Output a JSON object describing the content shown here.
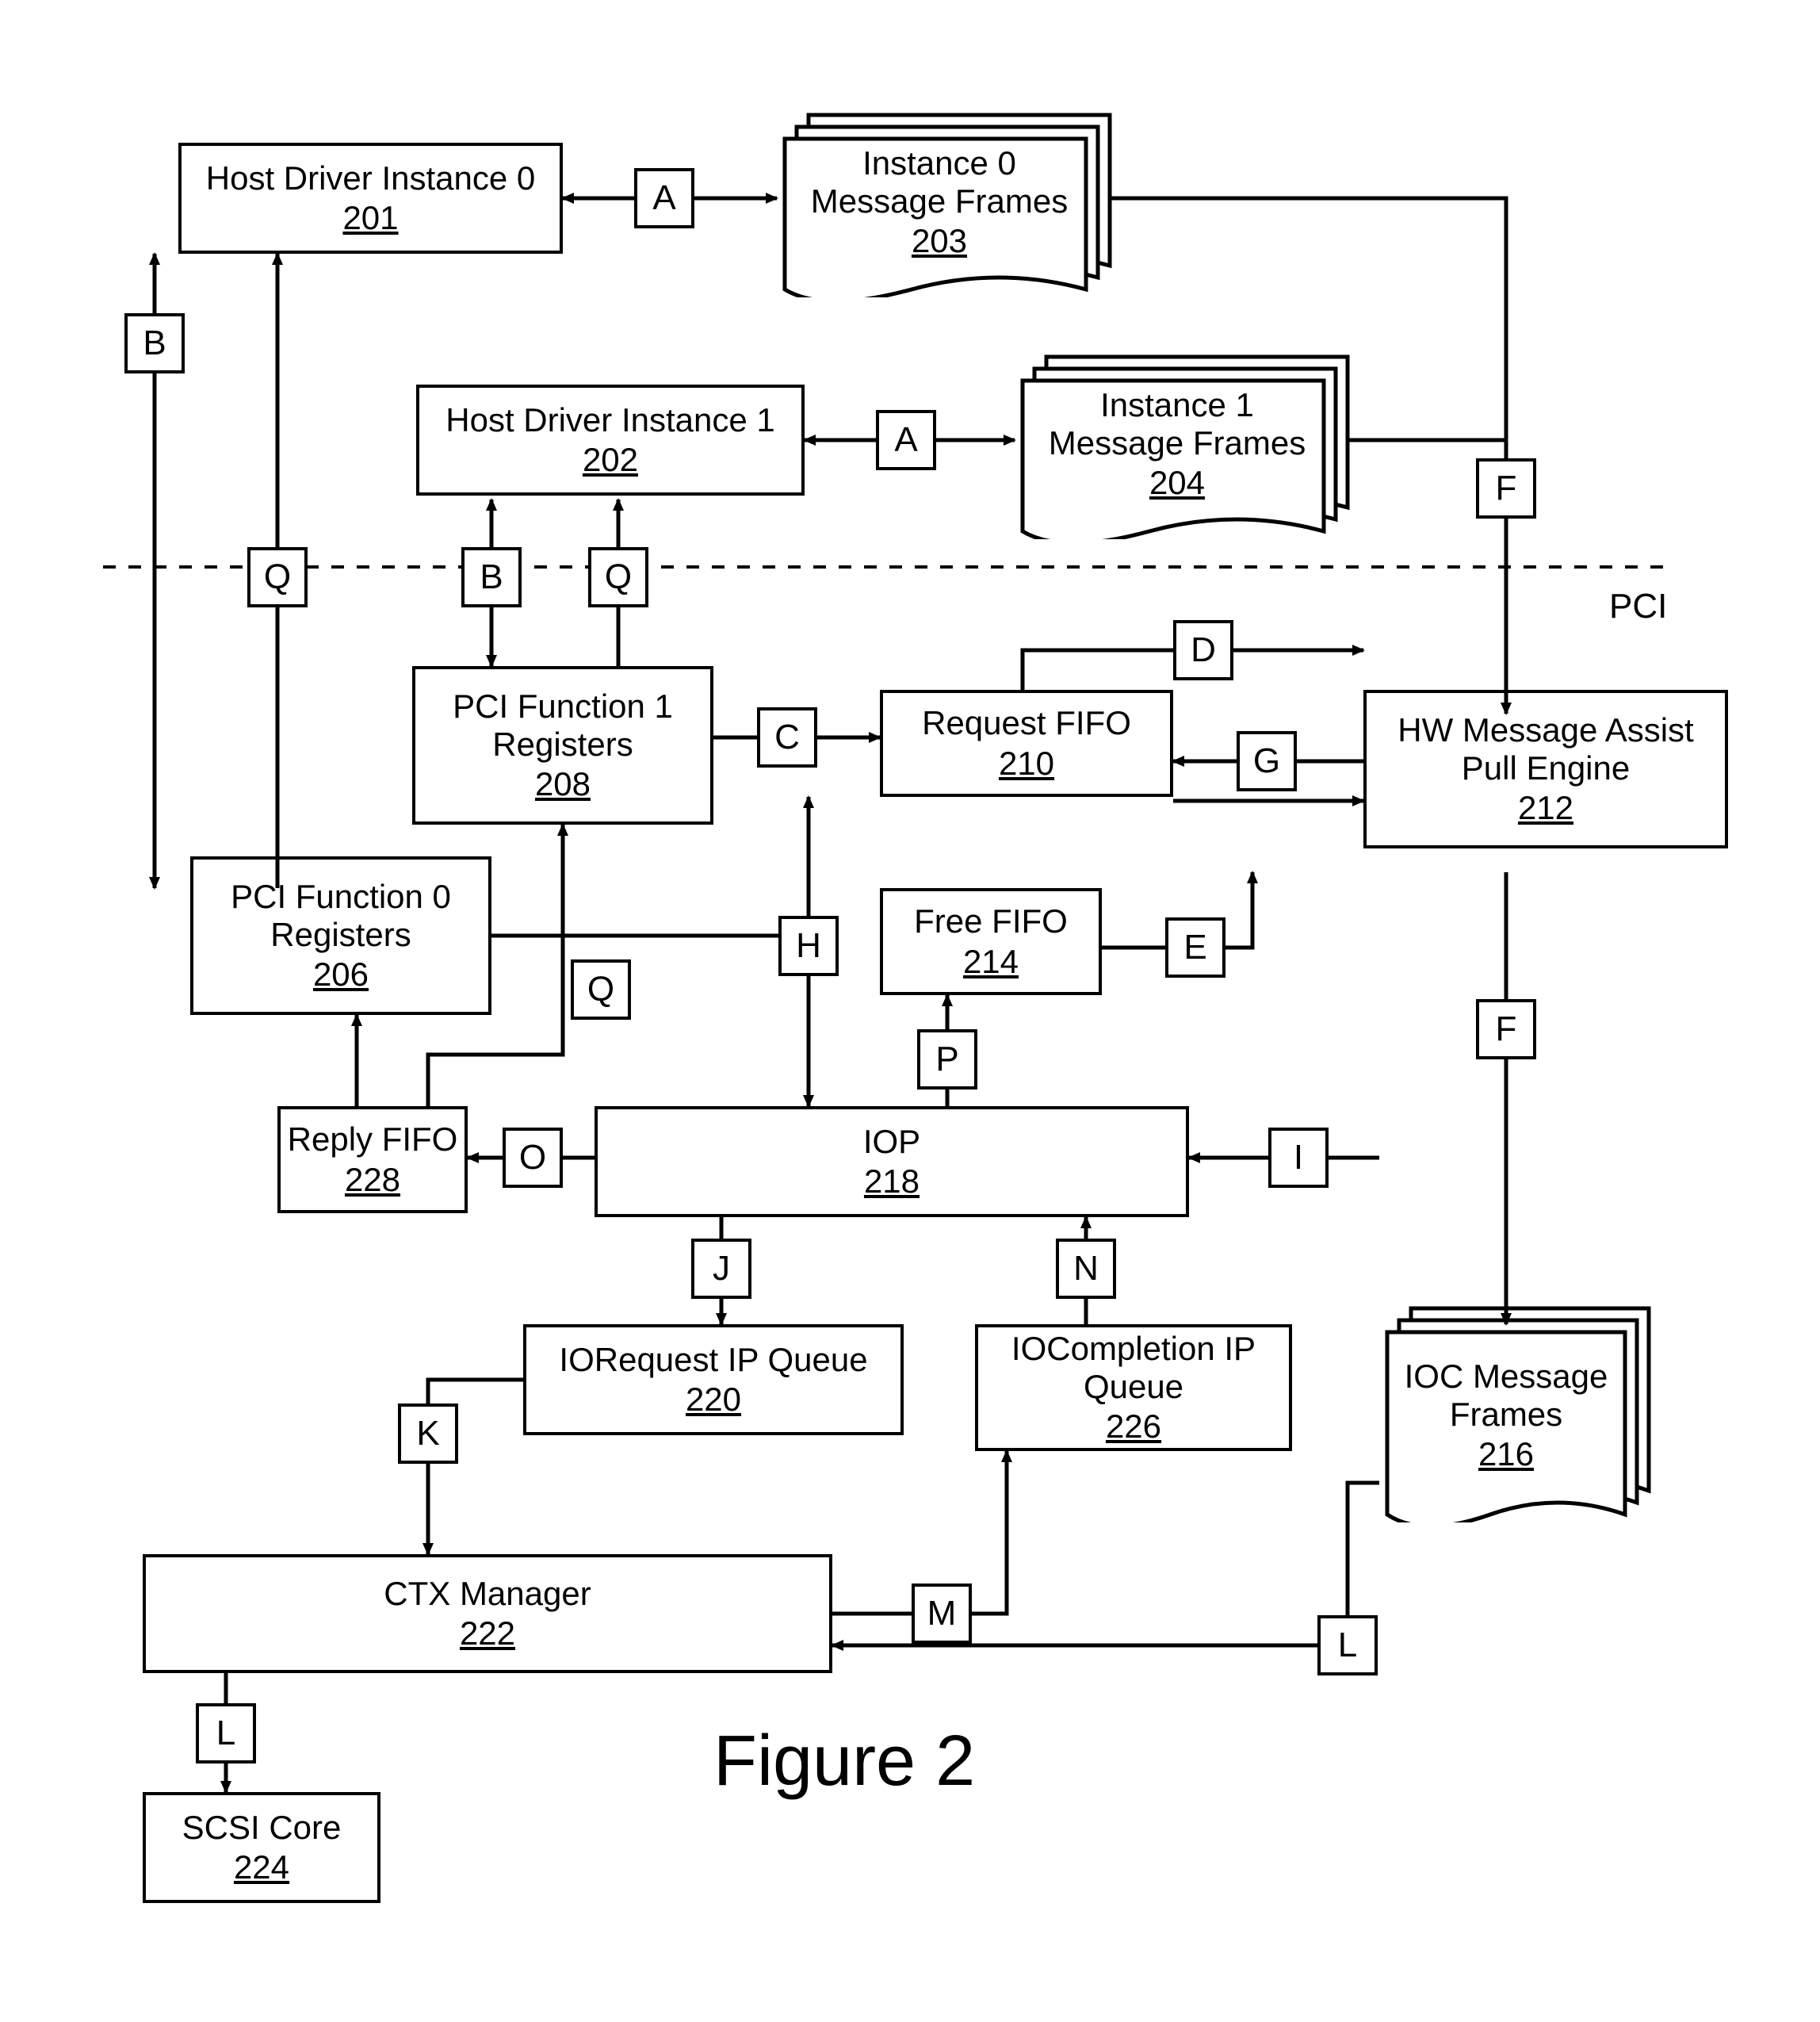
{
  "figure_title": "Figure 2",
  "pci_bus_label": "PCI",
  "blocks": {
    "hdi0": {
      "label": "Host Driver Instance 0",
      "ref": "201"
    },
    "hdi1": {
      "label": "Host Driver Instance 1",
      "ref": "202"
    },
    "mf0": {
      "label_l1": "Instance 0",
      "label_l2": "Message Frames",
      "ref": "203"
    },
    "mf1": {
      "label_l1": "Instance 1",
      "label_l2": "Message Frames",
      "ref": "204"
    },
    "pci0": {
      "label_l1": "PCI Function 0",
      "label_l2": "Registers",
      "ref": "206"
    },
    "pci1": {
      "label_l1": "PCI Function 1",
      "label_l2": "Registers",
      "ref": "208"
    },
    "reqfifo": {
      "label": "Request FIFO",
      "ref": "210"
    },
    "freefifo": {
      "label": "Free FIFO",
      "ref": "214"
    },
    "hwma": {
      "label_l1": "HW Message Assist",
      "label_l2": "Pull Engine",
      "ref": "212"
    },
    "iocmf": {
      "label_l1": "IOC Message",
      "label_l2": "Frames",
      "ref": "216"
    },
    "iop": {
      "label": "IOP",
      "ref": "218"
    },
    "ioreq": {
      "label": "IORequest IP Queue",
      "ref": "220"
    },
    "iocomp": {
      "label_l1": "IOCompletion IP",
      "label_l2": "Queue",
      "ref": "226"
    },
    "reply": {
      "label": "Reply FIFO",
      "ref": "228"
    },
    "ctx": {
      "label": "CTX Manager",
      "ref": "222"
    },
    "scsi": {
      "label": "SCSI Core",
      "ref": "224"
    }
  },
  "edge_letters": {
    "A": "A",
    "B": "B",
    "C": "C",
    "D": "D",
    "E": "E",
    "F": "F",
    "G": "G",
    "H": "H",
    "I": "I",
    "J": "J",
    "K": "K",
    "L": "L",
    "M": "M",
    "N": "N",
    "O": "O",
    "P": "P",
    "Q": "Q"
  }
}
